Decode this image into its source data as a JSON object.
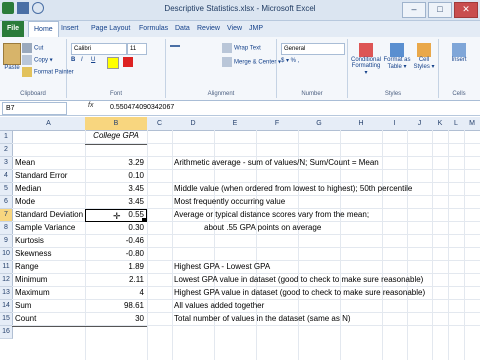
{
  "window": {
    "title": "Descriptive Statistics.xlsx - Microsoft Excel",
    "controls": [
      "–",
      "□",
      "✕"
    ]
  },
  "ribbon_tabs": [
    "File",
    "Home",
    "Insert",
    "Page Layout",
    "Formulas",
    "Data",
    "Review",
    "View",
    "JMP"
  ],
  "ribbon": {
    "clipboard": {
      "paste": "Paste",
      "cut": "Cut",
      "copy": "Copy ▾",
      "format_painter": "Format Painter",
      "label": "Clipboard"
    },
    "font": {
      "name": "Calibri",
      "size": "11",
      "label": "Font"
    },
    "alignment": {
      "wrap": "Wrap Text",
      "merge": "Merge & Center ▾",
      "label": "Alignment"
    },
    "number": {
      "format": "General",
      "label": "Number"
    },
    "styles": {
      "conditional": "Conditional Formatting ▾",
      "format_table": "Format as Table ▾",
      "cell_styles": "Cell Styles ▾",
      "label": "Styles"
    },
    "cells": {
      "insert": "Insert",
      "label": "Cells"
    }
  },
  "formula_bar": {
    "name_box": "B7",
    "fx": "fx",
    "value": "0.550474090342067"
  },
  "columns": [
    "A",
    "B",
    "C",
    "D",
    "E",
    "F",
    "G",
    "H",
    "I",
    "J",
    "K",
    "L",
    "M"
  ],
  "rows": [
    "1",
    "2",
    "3",
    "4",
    "5",
    "6",
    "7",
    "8",
    "9",
    "10",
    "11",
    "12",
    "13",
    "14",
    "15",
    "16"
  ],
  "sheet": {
    "header": "College GPA",
    "stats": [
      {
        "label": "Mean",
        "value": "3.29",
        "note": "Arithmetic average - sum of values/N; Sum/Count = Mean"
      },
      {
        "label": "Standard Error",
        "value": "0.10",
        "note": ""
      },
      {
        "label": "Median",
        "value": "3.45",
        "note": "Middle value (when ordered from lowest to highest); 50th percentile"
      },
      {
        "label": "Mode",
        "value": "3.45",
        "note": "Most frequently occurring value"
      },
      {
        "label": "Standard Deviation",
        "value": "0.55",
        "note": "Average or typical distance scores vary from the mean;"
      },
      {
        "label": "Sample Variance",
        "value": "0.30",
        "note": "about .55 GPA points on average"
      },
      {
        "label": "Kurtosis",
        "value": "-0.46",
        "note": ""
      },
      {
        "label": "Skewness",
        "value": "-0.80",
        "note": ""
      },
      {
        "label": "Range",
        "value": "1.89",
        "note": "Highest GPA - Lowest GPA"
      },
      {
        "label": "Minimum",
        "value": "2.11",
        "note": "Lowest GPA value in dataset (good to check to make sure reasonable)"
      },
      {
        "label": "Maximum",
        "value": "4",
        "note": "Highest GPA value in dataset (good to check to make sure reasonable)"
      },
      {
        "label": "Sum",
        "value": "98.61",
        "note": "All values added together"
      },
      {
        "label": "Count",
        "value": "30",
        "note": "Total number of values in the dataset (same as N)"
      }
    ]
  }
}
